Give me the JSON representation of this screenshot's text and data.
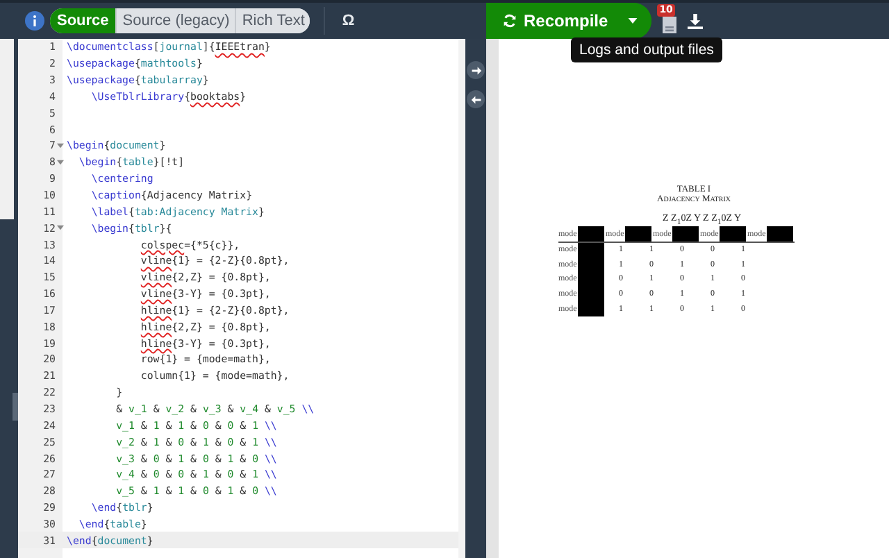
{
  "toolbar": {
    "tabs": [
      {
        "label": "Source",
        "selected": true
      },
      {
        "label": "Source (legacy)",
        "selected": false
      },
      {
        "label": "Rich Text",
        "selected": false
      }
    ],
    "symbol_button": "Ω",
    "recompile": "Recompile",
    "log_badge": "10",
    "tooltip": "Logs and output files"
  },
  "editor": {
    "lines": [
      {
        "n": "1",
        "fold": false,
        "current": false,
        "tokens": [
          {
            "kind": "cmd",
            "t": "\\documentclass"
          },
          {
            "kind": "plain",
            "t": "["
          },
          {
            "kind": "arg",
            "t": "journal"
          },
          {
            "kind": "plain",
            "t": "]{"
          },
          {
            "kind": "spell",
            "t": "IEEEtran"
          },
          {
            "kind": "plain",
            "t": "}"
          }
        ]
      },
      {
        "n": "2",
        "fold": false,
        "current": false,
        "tokens": [
          {
            "kind": "cmd",
            "t": "\\usepackage"
          },
          {
            "kind": "plain",
            "t": "{"
          },
          {
            "kind": "arg",
            "t": "mathtools"
          },
          {
            "kind": "plain",
            "t": "}"
          }
        ]
      },
      {
        "n": "3",
        "fold": false,
        "current": false,
        "tokens": [
          {
            "kind": "cmd",
            "t": "\\usepackage"
          },
          {
            "kind": "plain",
            "t": "{"
          },
          {
            "kind": "arg",
            "t": "tabularray"
          },
          {
            "kind": "plain",
            "t": "}"
          }
        ]
      },
      {
        "n": "4",
        "fold": false,
        "current": false,
        "tokens": [
          {
            "kind": "cmd",
            "t": "    \\UseTblrLibrary"
          },
          {
            "kind": "plain",
            "t": "{"
          },
          {
            "kind": "spell",
            "t": "booktabs"
          },
          {
            "kind": "plain",
            "t": "}"
          }
        ]
      },
      {
        "n": "5",
        "fold": false,
        "current": false
      },
      {
        "n": "6",
        "fold": false,
        "current": false
      },
      {
        "n": "7",
        "fold": true,
        "current": false,
        "tokens": [
          {
            "kind": "cmd",
            "t": "\\begin"
          },
          {
            "kind": "plain",
            "t": "{"
          },
          {
            "kind": "arg",
            "t": "document"
          },
          {
            "kind": "plain",
            "t": "}"
          }
        ]
      },
      {
        "n": "8",
        "fold": true,
        "current": false,
        "tokens": [
          {
            "kind": "cmd",
            "t": "  \\begin"
          },
          {
            "kind": "plain",
            "t": "{"
          },
          {
            "kind": "arg",
            "t": "table"
          },
          {
            "kind": "plain",
            "t": "}[!t]"
          }
        ]
      },
      {
        "n": "9",
        "fold": false,
        "current": false,
        "tokens": [
          {
            "kind": "cmd",
            "t": "    \\centering"
          }
        ]
      },
      {
        "n": "10",
        "fold": false,
        "current": false,
        "tokens": [
          {
            "kind": "cmd",
            "t": "    \\caption"
          },
          {
            "kind": "plain",
            "t": "{Adjacency Matrix}"
          }
        ]
      },
      {
        "n": "11",
        "fold": false,
        "current": false,
        "tokens": [
          {
            "kind": "cmd",
            "t": "    \\label"
          },
          {
            "kind": "plain",
            "t": "{"
          },
          {
            "kind": "arg",
            "t": "tab:Adjacency Matrix"
          },
          {
            "kind": "plain",
            "t": "}"
          }
        ]
      },
      {
        "n": "12",
        "fold": true,
        "current": false,
        "tokens": [
          {
            "kind": "cmd",
            "t": "    \\begin"
          },
          {
            "kind": "plain",
            "t": "{"
          },
          {
            "kind": "arg",
            "t": "tblr"
          },
          {
            "kind": "plain",
            "t": "}{"
          }
        ]
      },
      {
        "n": "13",
        "fold": false,
        "current": false,
        "tokens": [
          {
            "kind": "spell",
            "t": "            colspec"
          },
          {
            "kind": "plain",
            "t": "={*5{c}},"
          }
        ]
      },
      {
        "n": "14",
        "fold": false,
        "current": false,
        "tokens": [
          {
            "kind": "spell",
            "t": "            vline"
          },
          {
            "kind": "plain",
            "t": "{1} = {2-Z}{0.8pt},"
          }
        ]
      },
      {
        "n": "15",
        "fold": false,
        "current": false,
        "tokens": [
          {
            "kind": "spell",
            "t": "            vline"
          },
          {
            "kind": "plain",
            "t": "{2,Z} = {0.8pt},"
          }
        ]
      },
      {
        "n": "16",
        "fold": false,
        "current": false,
        "tokens": [
          {
            "kind": "spell",
            "t": "            vline"
          },
          {
            "kind": "plain",
            "t": "{3-Y} = {0.3pt},"
          }
        ]
      },
      {
        "n": "17",
        "fold": false,
        "current": false,
        "tokens": [
          {
            "kind": "spell",
            "t": "            hline"
          },
          {
            "kind": "plain",
            "t": "{1} = {2-Z}{0.8pt},"
          }
        ]
      },
      {
        "n": "18",
        "fold": false,
        "current": false,
        "tokens": [
          {
            "kind": "spell",
            "t": "            hline"
          },
          {
            "kind": "plain",
            "t": "{2,Z} = {0.8pt},"
          }
        ]
      },
      {
        "n": "19",
        "fold": false,
        "current": false,
        "tokens": [
          {
            "kind": "spell",
            "t": "            hline"
          },
          {
            "kind": "plain",
            "t": "{3-Y} = {0.3pt},"
          }
        ]
      },
      {
        "n": "20",
        "fold": false,
        "current": false,
        "tokens": [
          {
            "kind": "plain",
            "t": "            row{1} = {mode=math},"
          }
        ]
      },
      {
        "n": "21",
        "fold": false,
        "current": false,
        "tokens": [
          {
            "kind": "plain",
            "t": "            column{1} = {mode=math},"
          }
        ]
      },
      {
        "n": "22",
        "fold": false,
        "current": false,
        "tokens": [
          {
            "kind": "plain",
            "t": "        }"
          }
        ]
      },
      {
        "n": "23",
        "fold": false,
        "current": false,
        "tokens": [
          {
            "kind": "plain",
            "t": "        & "
          },
          {
            "kind": "math",
            "t": "v_1"
          },
          {
            "kind": "plain",
            "t": " & "
          },
          {
            "kind": "math",
            "t": "v_2"
          },
          {
            "kind": "plain",
            "t": " & "
          },
          {
            "kind": "math",
            "t": "v_3"
          },
          {
            "kind": "plain",
            "t": " & "
          },
          {
            "kind": "math",
            "t": "v_4"
          },
          {
            "kind": "plain",
            "t": " & "
          },
          {
            "kind": "math",
            "t": "v_5"
          },
          {
            "kind": "cmd",
            "t": " \\\\"
          }
        ]
      },
      {
        "n": "24",
        "fold": false,
        "current": false,
        "tokens": [
          {
            "kind": "math",
            "t": "        v_1"
          },
          {
            "kind": "plain",
            "t": " & "
          },
          {
            "kind": "math",
            "t": "1"
          },
          {
            "kind": "plain",
            "t": " & "
          },
          {
            "kind": "math",
            "t": "1"
          },
          {
            "kind": "plain",
            "t": " & "
          },
          {
            "kind": "math",
            "t": "0"
          },
          {
            "kind": "plain",
            "t": " & "
          },
          {
            "kind": "math",
            "t": "0"
          },
          {
            "kind": "plain",
            "t": " & "
          },
          {
            "kind": "math",
            "t": "1"
          },
          {
            "kind": "cmd",
            "t": " \\\\"
          }
        ]
      },
      {
        "n": "25",
        "fold": false,
        "current": false,
        "tokens": [
          {
            "kind": "math",
            "t": "        v_2"
          },
          {
            "kind": "plain",
            "t": " & "
          },
          {
            "kind": "math",
            "t": "1"
          },
          {
            "kind": "plain",
            "t": " & "
          },
          {
            "kind": "math",
            "t": "0"
          },
          {
            "kind": "plain",
            "t": " & "
          },
          {
            "kind": "math",
            "t": "1"
          },
          {
            "kind": "plain",
            "t": " & "
          },
          {
            "kind": "math",
            "t": "0"
          },
          {
            "kind": "plain",
            "t": " & "
          },
          {
            "kind": "math",
            "t": "1"
          },
          {
            "kind": "cmd",
            "t": " \\\\"
          }
        ]
      },
      {
        "n": "26",
        "fold": false,
        "current": false,
        "tokens": [
          {
            "kind": "math",
            "t": "        v_3"
          },
          {
            "kind": "plain",
            "t": " & "
          },
          {
            "kind": "math",
            "t": "0"
          },
          {
            "kind": "plain",
            "t": " & "
          },
          {
            "kind": "math",
            "t": "1"
          },
          {
            "kind": "plain",
            "t": " & "
          },
          {
            "kind": "math",
            "t": "0"
          },
          {
            "kind": "plain",
            "t": " & "
          },
          {
            "kind": "math",
            "t": "1"
          },
          {
            "kind": "plain",
            "t": " & "
          },
          {
            "kind": "math",
            "t": "0"
          },
          {
            "kind": "cmd",
            "t": " \\\\"
          }
        ]
      },
      {
        "n": "27",
        "fold": false,
        "current": false,
        "tokens": [
          {
            "kind": "math",
            "t": "        v_4"
          },
          {
            "kind": "plain",
            "t": " & "
          },
          {
            "kind": "math",
            "t": "0"
          },
          {
            "kind": "plain",
            "t": " & "
          },
          {
            "kind": "math",
            "t": "0"
          },
          {
            "kind": "plain",
            "t": " & "
          },
          {
            "kind": "math",
            "t": "1"
          },
          {
            "kind": "plain",
            "t": " & "
          },
          {
            "kind": "math",
            "t": "0"
          },
          {
            "kind": "plain",
            "t": " & "
          },
          {
            "kind": "math",
            "t": "1"
          },
          {
            "kind": "cmd",
            "t": " \\\\"
          }
        ]
      },
      {
        "n": "28",
        "fold": false,
        "current": false,
        "tokens": [
          {
            "kind": "math",
            "t": "        v_5"
          },
          {
            "kind": "plain",
            "t": " & "
          },
          {
            "kind": "math",
            "t": "1"
          },
          {
            "kind": "plain",
            "t": " & "
          },
          {
            "kind": "math",
            "t": "1"
          },
          {
            "kind": "plain",
            "t": " & "
          },
          {
            "kind": "math",
            "t": "0"
          },
          {
            "kind": "plain",
            "t": " & "
          },
          {
            "kind": "math",
            "t": "1"
          },
          {
            "kind": "plain",
            "t": " & "
          },
          {
            "kind": "math",
            "t": "0"
          },
          {
            "kind": "cmd",
            "t": " \\\\"
          }
        ]
      },
      {
        "n": "29",
        "fold": false,
        "current": false,
        "tokens": [
          {
            "kind": "cmd",
            "t": "    \\end"
          },
          {
            "kind": "plain",
            "t": "{"
          },
          {
            "kind": "arg",
            "t": "tblr"
          },
          {
            "kind": "plain",
            "t": "}"
          }
        ]
      },
      {
        "n": "30",
        "fold": false,
        "current": false,
        "tokens": [
          {
            "kind": "cmd",
            "t": "  \\end"
          },
          {
            "kind": "plain",
            "t": "{"
          },
          {
            "kind": "arg",
            "t": "table"
          },
          {
            "kind": "plain",
            "t": "}"
          }
        ]
      },
      {
        "n": "31",
        "fold": false,
        "current": true,
        "tokens": [
          {
            "kind": "cmd",
            "t": "\\end"
          },
          {
            "kind": "plain",
            "t": "{"
          },
          {
            "kind": "arg",
            "t": "document"
          },
          {
            "kind": "plain",
            "t": "}"
          }
        ]
      }
    ]
  },
  "preview": {
    "table_label": "TABLE I",
    "caption": "Adjacency Matrix",
    "header_math": "Z Z$_{1}$0Z Y Z Z$_{1}$0Z Y",
    "header_row": [
      "mode",
      "mode",
      "mode",
      "mode",
      "mode"
    ],
    "rows": [
      {
        "label": "mode",
        "values": [
          "1",
          "1",
          "0",
          "0",
          "1"
        ]
      },
      {
        "label": "mode",
        "values": [
          "1",
          "0",
          "1",
          "0",
          "1"
        ]
      },
      {
        "label": "mode",
        "values": [
          "0",
          "1",
          "0",
          "1",
          "0"
        ]
      },
      {
        "label": "mode",
        "values": [
          "0",
          "0",
          "1",
          "0",
          "1"
        ]
      },
      {
        "label": "mode",
        "values": [
          "1",
          "1",
          "0",
          "1",
          "0"
        ]
      }
    ]
  }
}
